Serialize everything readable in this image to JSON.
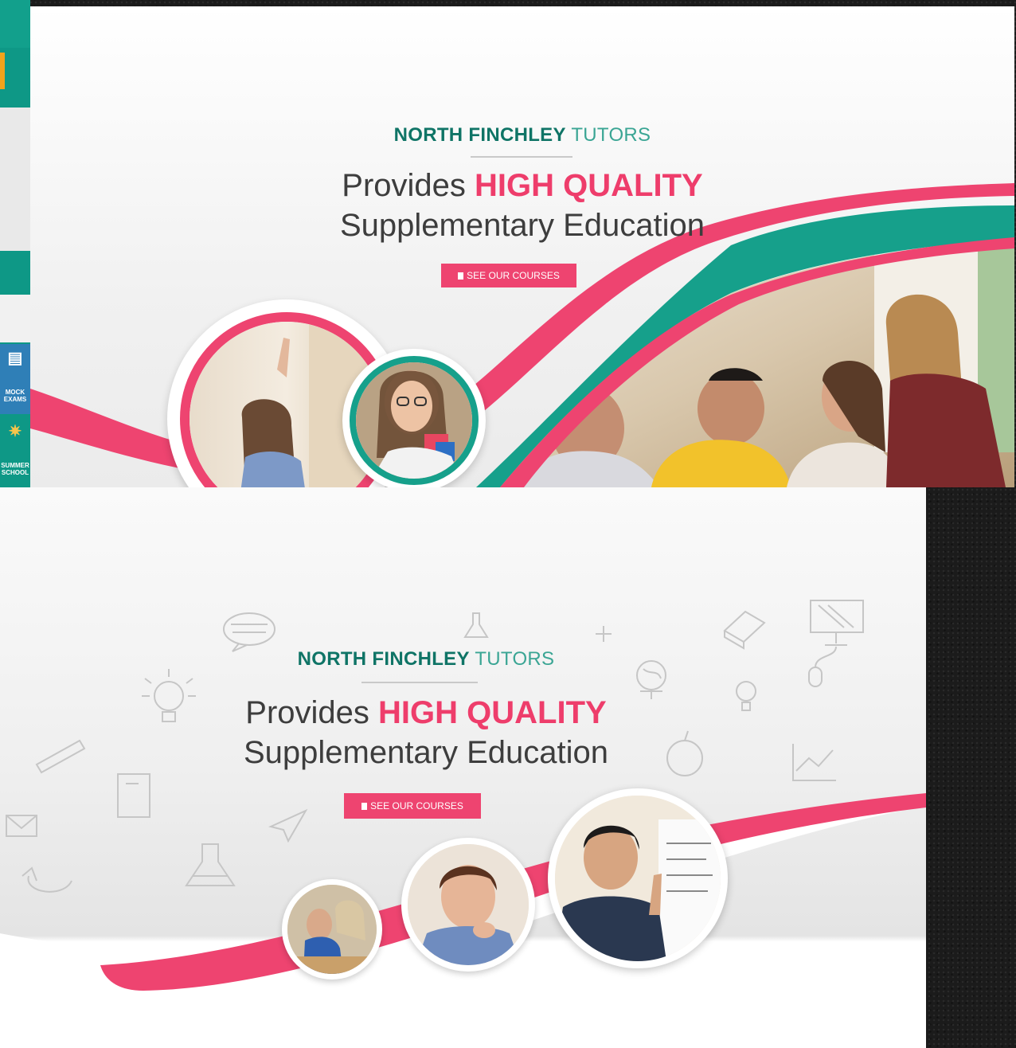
{
  "brand": {
    "name_bold": "NORTH FINCHLEY",
    "name_light": "TUTORS"
  },
  "headline": {
    "prefix": "Provides",
    "highlight": "HIGH QUALITY",
    "line2": "Supplementary Education"
  },
  "cta": {
    "label": "SEE OUR COURSES"
  },
  "left_strip": {
    "items": [
      {
        "label_line1": "MOCK",
        "label_line2": "EXAMS"
      },
      {
        "label_line1": "SUMMER",
        "label_line2": "SCHOOL"
      }
    ]
  },
  "colors": {
    "teal": "#0f7466",
    "teal_light": "#3aa594",
    "pink": "#ee3d6b",
    "green_band": "#14a08a"
  },
  "icons": [
    "speech-bubble-icon",
    "flask-icon",
    "plus-icon",
    "book-icon",
    "monitor-icon",
    "mouse-icon",
    "lightbulb-icon",
    "globe-icon",
    "ruler-icon",
    "notepad-icon",
    "envelope-icon",
    "paper-plane-icon",
    "beaker-icon",
    "apple-icon",
    "chart-icon",
    "book-bookmark-icon"
  ]
}
